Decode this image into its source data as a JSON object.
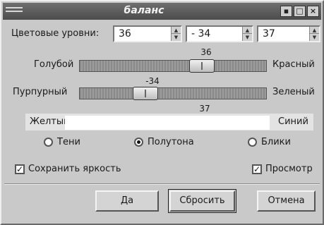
{
  "window": {
    "title": "баланс",
    "buttons": [
      "menu-icon",
      "maximize-icon",
      "close-icon"
    ]
  },
  "levels": {
    "label": "Цветовые уровни:",
    "values": [
      "36",
      "- 34",
      "37"
    ]
  },
  "sliders": [
    {
      "left_label": "Голубой",
      "right_label": "Красный",
      "value_label": "36",
      "value": 36
    },
    {
      "left_label": "Пурпурный",
      "right_label": "Зеленый",
      "value_label": "-34",
      "value": -34
    },
    {
      "left_label": "Желтый",
      "right_label": "Синий",
      "value_label": "37",
      "value": 37
    }
  ],
  "slider_range": [
    -100,
    100
  ],
  "tone": {
    "options": [
      "Тени",
      "Полутона",
      "Блики"
    ],
    "selected": "Полутона"
  },
  "checks": {
    "preserve": "Сохранить яркость",
    "preview": "Просмотр",
    "preserve_checked": true,
    "preview_checked": true
  },
  "buttons": {
    "ok": "Да",
    "reset": "Сбросить",
    "cancel": "Отмена"
  }
}
